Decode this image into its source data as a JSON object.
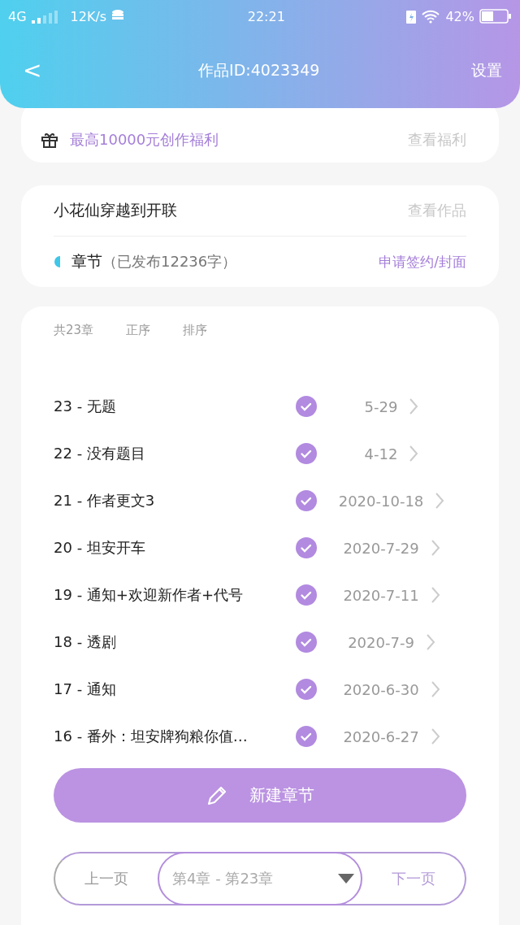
{
  "status_bar": {
    "network": "4G",
    "speed": "12K/s",
    "time": "22:21",
    "battery": "42%"
  },
  "header": {
    "back": "<",
    "title": "作品ID:4023349",
    "settings": "设置"
  },
  "promo": {
    "text": "最高10000元创作福利",
    "link": "查看福利"
  },
  "work": {
    "title": "小花仙穿越到开联",
    "view": "查看作品",
    "section": "章节",
    "published_info": "（已发布12236字）",
    "apply": "申请签约/封面"
  },
  "list_header": {
    "count": "共23章",
    "order": "正序",
    "sort": "排序"
  },
  "chapters": [
    {
      "title": "23 - 无题",
      "date": "5-29",
      "published": true
    },
    {
      "title": "22 - 没有题目",
      "date": "4-12",
      "published": true
    },
    {
      "title": "21 - 作者更文3",
      "date": "2020-10-18",
      "published": true
    },
    {
      "title": "20 - 坦安开车",
      "date": "2020-7-29",
      "published": true
    },
    {
      "title": "19 - 通知+欢迎新作者+代号",
      "date": "2020-7-11",
      "published": true
    },
    {
      "title": "18 - 透剧",
      "date": "2020-7-9",
      "published": true
    },
    {
      "title": "17 - 通知",
      "date": "2020-6-30",
      "published": true
    },
    {
      "title": "16 - 番外：坦安牌狗粮你值…",
      "date": "2020-6-27",
      "published": true
    }
  ],
  "new_chapter": "新建章节",
  "pagination": {
    "prev": "上一页",
    "range": "第4章 - 第23章",
    "next": "下一页"
  }
}
